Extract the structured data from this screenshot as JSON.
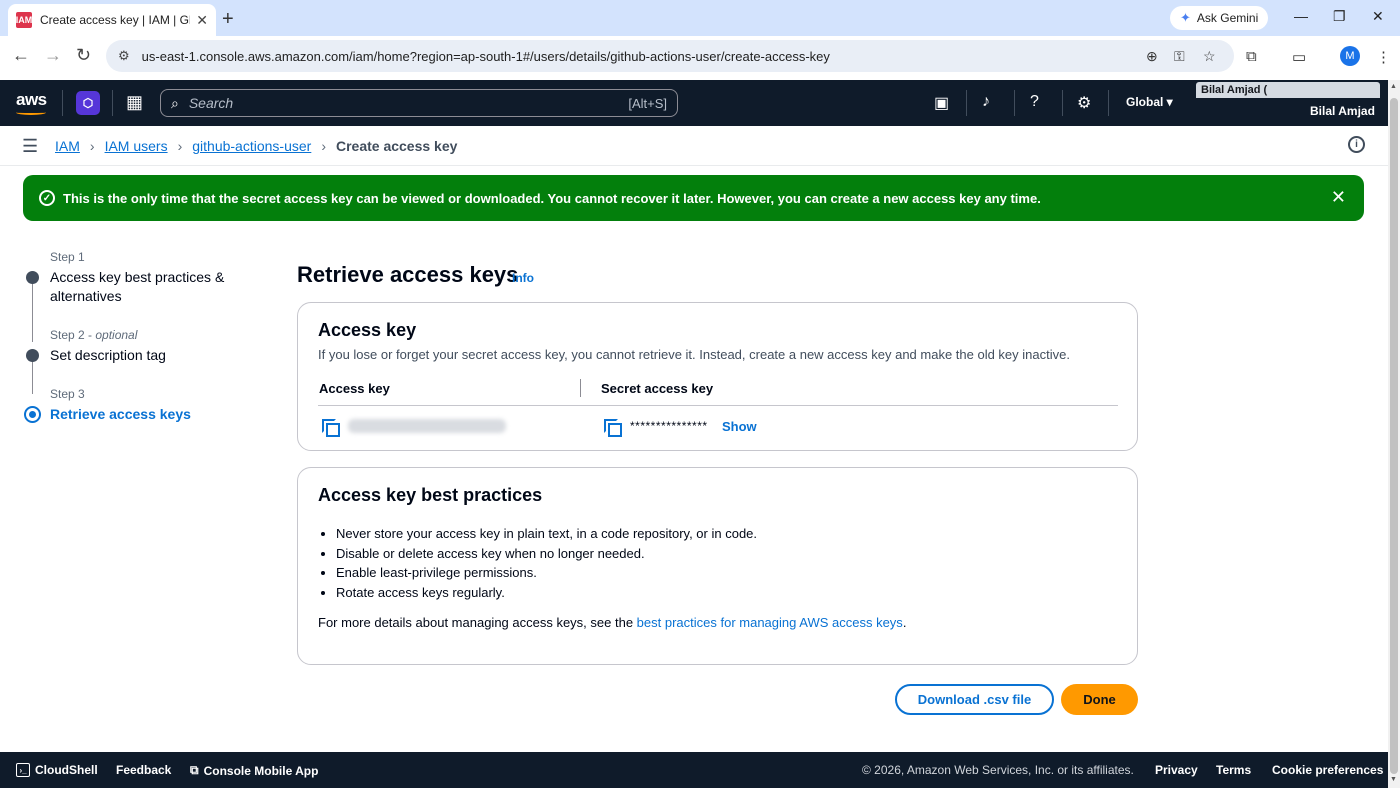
{
  "browser": {
    "tab_title": "Create access key | IAM | Global",
    "favicon_text": "IAM",
    "new_tab": "+",
    "ask_gemini": "Ask Gemini",
    "url": "us-east-1.console.aws.amazon.com/iam/home?region=ap-south-1#/users/details/github-actions-user/create-access-key",
    "profile_initial": "M"
  },
  "aws_nav": {
    "logo": "aws",
    "search_placeholder": "Search",
    "search_shortcut": "[Alt+S]",
    "region": "Global",
    "account_top": "Bilal Amjad (",
    "account_name": "Bilal Amjad"
  },
  "breadcrumbs": {
    "items": [
      "IAM",
      "IAM users",
      "github-actions-user"
    ],
    "current": "Create access key"
  },
  "flash": {
    "message": "This is the only time that the secret access key can be viewed or downloaded. You cannot recover it later. However, you can create a new access key any time."
  },
  "steps": [
    {
      "label": "Step 1",
      "optional": "",
      "title": "Access key best practices & alternatives"
    },
    {
      "label": "Step 2 - ",
      "optional": "optional",
      "title": "Set description tag"
    },
    {
      "label": "Step 3",
      "optional": "",
      "title": "Retrieve access keys"
    }
  ],
  "main": {
    "title": "Retrieve access keys",
    "info": "Info",
    "access_key_card": {
      "heading": "Access key",
      "description": "If you lose or forget your secret access key, you cannot retrieve it. Instead, create a new access key and make the old key inactive.",
      "col_access_key": "Access key",
      "col_secret": "Secret access key",
      "secret_mask": "***************",
      "show": "Show"
    },
    "best_practices_card": {
      "heading": "Access key best practices",
      "bullets": [
        "Never store your access key in plain text, in a code repository, or in code.",
        "Disable or delete access key when no longer needed.",
        "Enable least-privilege permissions.",
        "Rotate access keys regularly."
      ],
      "more_prefix": "For more details about managing access keys, see the ",
      "more_link": "best practices for managing AWS access keys",
      "more_suffix": "."
    },
    "download_button": "Download .csv file",
    "done_button": "Done"
  },
  "footer": {
    "cloudshell": "CloudShell",
    "feedback": "Feedback",
    "mobile_app": "Console Mobile App",
    "copyright": "© 2026, Amazon Web Services, Inc. or its affiliates.",
    "privacy": "Privacy",
    "terms": "Terms",
    "cookies": "Cookie preferences"
  },
  "colors": {
    "flash_green": "#037f0c",
    "link_blue": "#0972d3",
    "primary_orange": "#ff9900",
    "nav_dark": "#0f1b2a"
  }
}
